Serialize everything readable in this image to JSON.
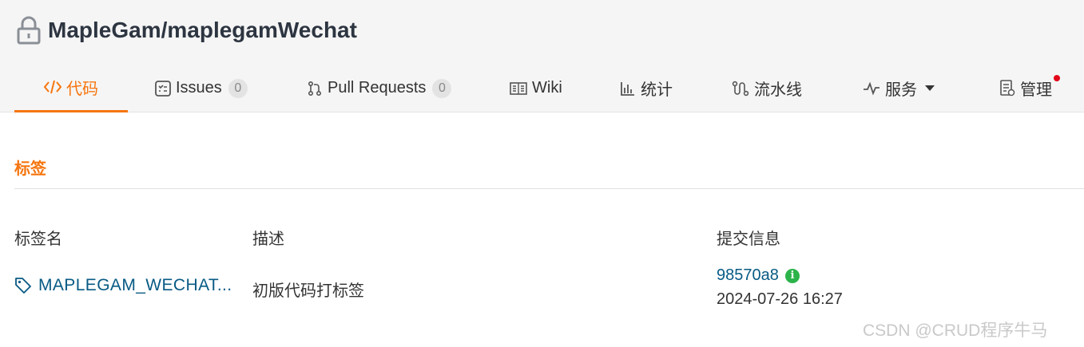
{
  "repo": {
    "name": "MapleGam/maplegamWechat",
    "icon": "lock-icon"
  },
  "tabs": [
    {
      "label": "代码",
      "icon": "code-icon",
      "active": true
    },
    {
      "label": "Issues",
      "icon": "issues-icon",
      "count": "0"
    },
    {
      "label": "Pull Requests",
      "icon": "pull-request-icon",
      "count": "0"
    },
    {
      "label": "Wiki",
      "icon": "wiki-icon"
    },
    {
      "label": "统计",
      "icon": "stats-icon"
    },
    {
      "label": "流水线",
      "icon": "pipeline-icon"
    },
    {
      "label": "服务",
      "icon": "service-icon",
      "dropdown": true
    },
    {
      "label": "管理",
      "icon": "manage-icon",
      "notification_dot": true
    }
  ],
  "section": {
    "title": "标签"
  },
  "table": {
    "headers": [
      "标签名",
      "描述",
      "提交信息"
    ],
    "rows": [
      {
        "tag_name": "MAPLEGAM_WECHAT...",
        "description": "初版代码打标签",
        "commit_hash": "98570a8",
        "commit_date": "2024-07-26 16:27"
      }
    ]
  },
  "watermark": "CSDN @CRUD程序牛马",
  "colors": {
    "accent": "#f6750e",
    "link": "#075a84",
    "verified": "#2bb34a",
    "dot": "#e3061a"
  }
}
